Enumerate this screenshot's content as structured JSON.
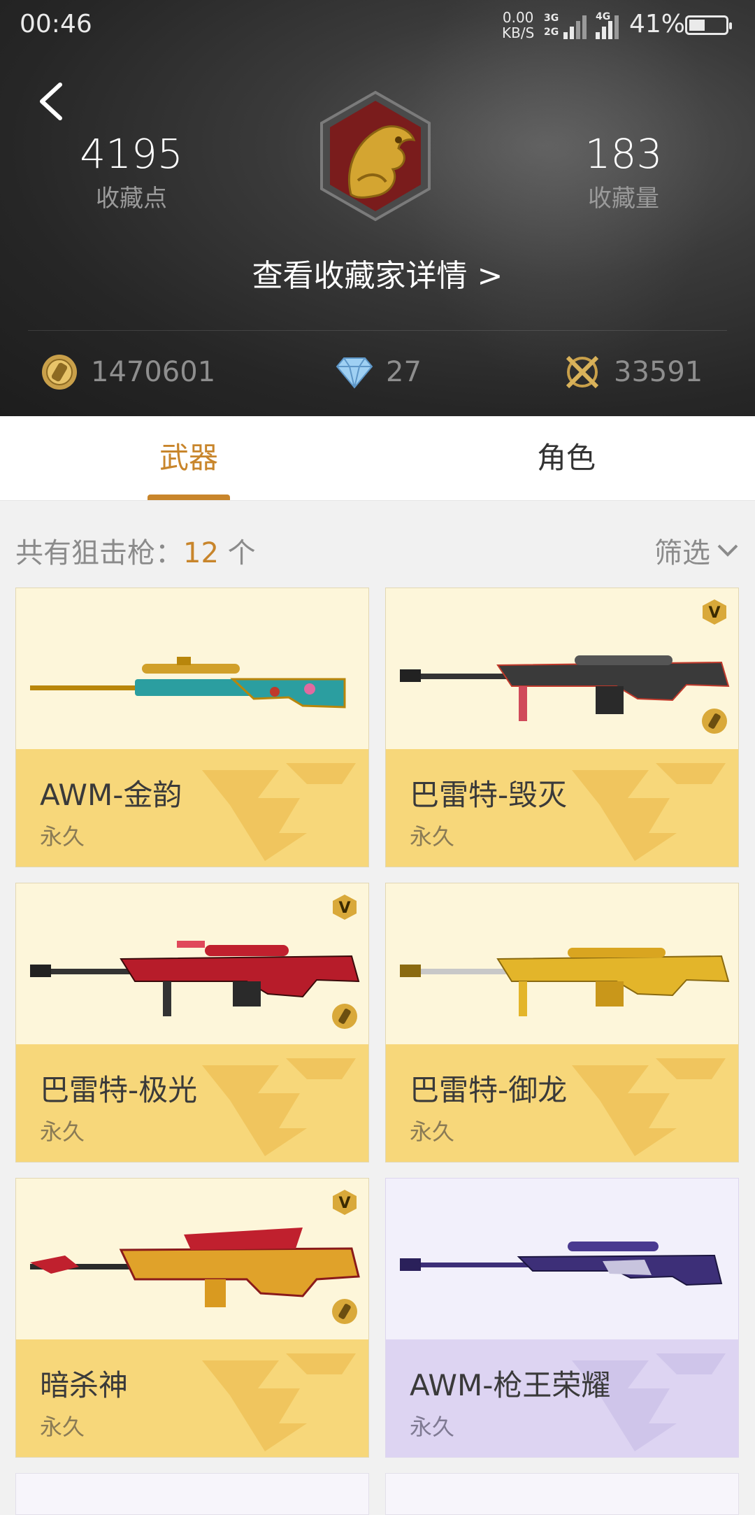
{
  "status_bar": {
    "time": "00:46",
    "net_speed": "0.00",
    "net_unit": "KB/S",
    "sim1": "3G",
    "sim1b": "2G",
    "sim2": "4G",
    "battery": "41%"
  },
  "profile": {
    "collection_points": "4195",
    "collection_points_label": "收藏点",
    "collection_count": "183",
    "collection_count_label": "收藏量",
    "detail_link": "查看收藏家详情 >"
  },
  "currencies": [
    {
      "icon": "gold-coin-icon",
      "value": "1470601"
    },
    {
      "icon": "diamond-icon",
      "value": "27"
    },
    {
      "icon": "crossed-swords-icon",
      "value": "33591"
    }
  ],
  "tabs": [
    {
      "label": "武器",
      "active": true
    },
    {
      "label": "角色",
      "active": false
    }
  ],
  "list_header": {
    "prefix": "共有狙击枪：",
    "count": "12",
    "suffix": " 个",
    "filter": "筛选"
  },
  "items": [
    {
      "name": "AWM-金韵",
      "duration": "永久",
      "theme": "gold"
    },
    {
      "name": "巴雷特-毁灭",
      "duration": "永久",
      "theme": "gold"
    },
    {
      "name": "巴雷特-极光",
      "duration": "永久",
      "theme": "gold"
    },
    {
      "name": "巴雷特-御龙",
      "duration": "永久",
      "theme": "gold"
    },
    {
      "name": "暗杀神",
      "duration": "永久",
      "theme": "gold"
    },
    {
      "name": "AWM-枪王荣耀",
      "duration": "永久",
      "theme": "purple"
    }
  ],
  "colors": {
    "accent": "#c8852b",
    "card_gold_top": "#fdf6da",
    "card_gold_bottom": "#f7d77a",
    "card_purple_top": "#f2f0fb",
    "card_purple_bottom": "#ddd4f2"
  }
}
